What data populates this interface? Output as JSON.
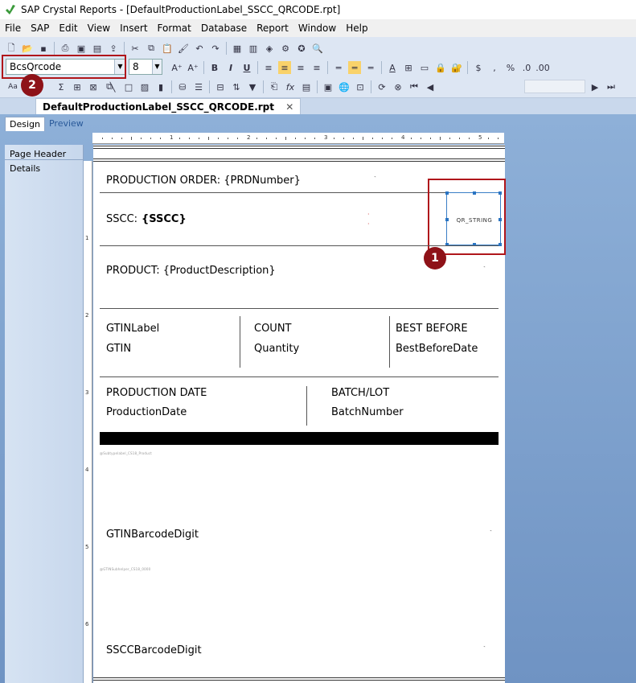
{
  "window": {
    "title": "SAP Crystal Reports - [DefaultProductionLabel_SSCC_QRCODE.rpt]"
  },
  "menu": [
    "File",
    "SAP",
    "Edit",
    "View",
    "Insert",
    "Format",
    "Database",
    "Report",
    "Window",
    "Help"
  ],
  "font": {
    "name": "BcsQrcode",
    "size": "8"
  },
  "document_tab": {
    "label": "DefaultProductionLabel_SSCC_QRCODE.rpt",
    "close": "✕"
  },
  "view_tabs": {
    "design": "Design",
    "preview": "Preview"
  },
  "sections": {
    "page_header": "Page Header",
    "details": "Details"
  },
  "callouts": {
    "one": "1",
    "two": "2"
  },
  "ruler": {
    "h": [
      "1",
      "2",
      "3",
      "4",
      "5"
    ],
    "v": [
      "1",
      "2",
      "3",
      "4",
      "5",
      "6"
    ]
  },
  "report": {
    "production_order": "PRODUCTION ORDER: {PRDNumber}",
    "sscc_label": "SSCC: ",
    "sscc_field": "{SSCC}",
    "qr_field": "QR_STRING",
    "product": "PRODUCT: {ProductDescription}",
    "gtin_label": "GTINLabel",
    "gtin": "GTIN",
    "count_label": "COUNT",
    "quantity": "Quantity",
    "best_before_label": "BEST BEFORE",
    "best_before_date": "BestBeforeDate",
    "production_date_label": "PRODUCTION DATE",
    "production_date": "ProductionDate",
    "batch_label": "BATCH/LOT",
    "batch_number": "BatchNumber",
    "small_1": "@Subtypelabel_CS18_Product",
    "gtin_barcode_digit": "GTINBarcodeDigit",
    "small_2": "@GTINSubhelper_CS18_0000",
    "sscc_barcode_digit": "SSCCBarcodeDigit"
  }
}
